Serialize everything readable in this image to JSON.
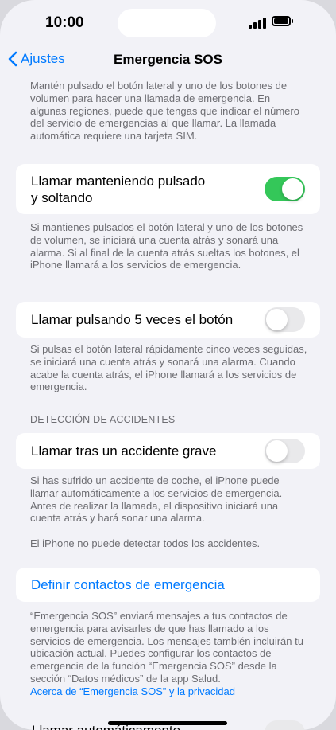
{
  "status_bar": {
    "time": "10:00"
  },
  "nav": {
    "back_label": "Ajustes",
    "title": "Emergencia SOS"
  },
  "intro_text": "Mantén pulsado el botón lateral y uno de los botones de volumen para hacer una llamada de emergencia. En algunas regiones, puede que tengas que indicar el número del servicio de emergencias al que llamar. La llamada automática requiere una tarjeta SIM.",
  "hold_release": {
    "label_line1": "Llamar manteniendo pulsado",
    "label_line2": "y soltando",
    "enabled": true,
    "footer": "Si mantienes pulsados el botón lateral y uno de los botones de volumen, se iniciará una cuenta atrás y sonará una alarma. Si al final de la cuenta atrás sueltas los botones, el iPhone llamará a los servicios de emergencia."
  },
  "five_presses": {
    "label": "Llamar pulsando 5 veces el botón",
    "enabled": false,
    "footer": "Si pulsas el botón lateral rápidamente cinco veces seguidas, se iniciará una cuenta atrás y sonará una alarma. Cuando acabe la cuenta atrás, el iPhone llamará a los servicios de emergencia."
  },
  "crash_detection": {
    "header": "DETECCIÓN DE ACCIDENTES",
    "label": "Llamar tras un accidente grave",
    "enabled": false,
    "footer": "Si has sufrido un accidente de coche, el iPhone puede llamar automáticamente a los servicios de emergencia. Antes de realizar la llamada, el dispositivo iniciará una cuenta atrás y hará sonar una alarma.",
    "note": "El iPhone no puede detectar todos los accidentes."
  },
  "emergency_contacts": {
    "link_label": "Definir contactos de emergencia",
    "footer": "“Emergencia SOS” enviará mensajes a tus contactos de emergencia para avisarles de que has llamado a los servicios de emergencia. Los mensajes también incluirán tu ubicación actual. Puedes configurar los contactos de emergencia de la función “Emergencia SOS” desde la sección “Datos médicos” de la app Salud.",
    "privacy_link": "Acerca de “Emergencia SOS” y la privacidad"
  },
  "peek_row": {
    "label": "Llamar automáticamente"
  },
  "colors": {
    "accent": "#007aff",
    "toggle_on": "#34c759",
    "toggle_off": "#e9e9eb",
    "background": "#f2f2f7"
  }
}
